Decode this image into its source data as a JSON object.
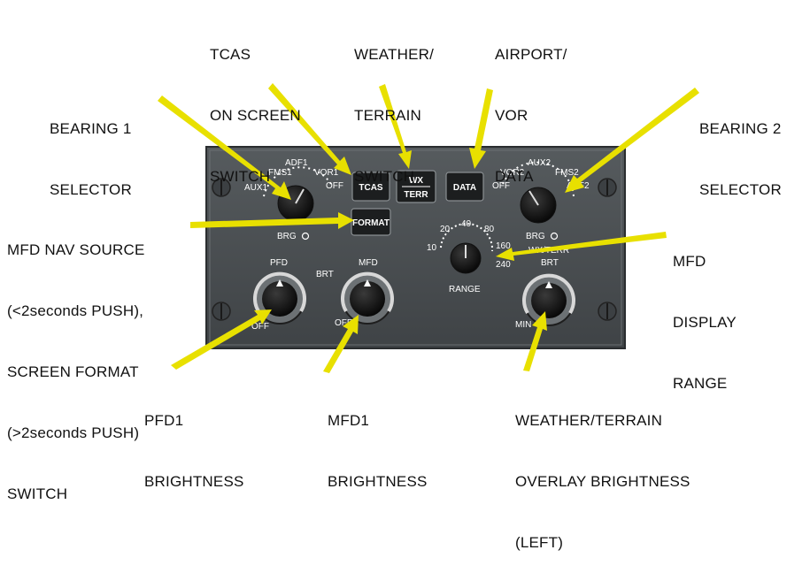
{
  "callouts": {
    "tcas_switch": [
      "TCAS",
      "ON SCREEN",
      "SWITCH"
    ],
    "weather_terrain_switch": [
      "WEATHER/",
      "TERRAIN",
      "SWITCH"
    ],
    "airport_vor_data": [
      "AIRPORT/",
      "VOR",
      "DATA"
    ],
    "bearing1_selector": [
      "BEARING 1",
      "SELECTOR"
    ],
    "bearing2_selector": [
      "BEARING 2",
      "SELECTOR"
    ],
    "mfd_nav_source": [
      "MFD NAV SOURCE",
      "(<2seconds PUSH),",
      "SCREEN FORMAT",
      "(>2seconds PUSH)",
      "SWITCH"
    ],
    "mfd_display_range": [
      "MFD",
      "DISPLAY",
      "RANGE"
    ],
    "pfd1_brightness": [
      "PFD1",
      "BRIGHTNESS"
    ],
    "mfd1_brightness": [
      "MFD1",
      "BRIGHTNESS"
    ],
    "overlay_brightness": [
      "WEATHER/TERRAIN",
      "OVERLAY BRIGHTNESS",
      "(LEFT)"
    ]
  },
  "panel": {
    "buttons": {
      "tcas": "TCAS",
      "wx_top": "WX",
      "wx_bottom": "TERR",
      "data": "DATA",
      "format": "FORMAT"
    },
    "bearing1": {
      "labels": [
        "AUX1",
        "FMS1",
        "ADF1",
        "VOR1",
        "OFF"
      ],
      "brg": "BRG"
    },
    "bearing2": {
      "labels": [
        "OFF",
        "VOR2",
        "AUX2",
        "FMS2",
        "ADF2"
      ],
      "brg": "BRG"
    },
    "range": {
      "ticks": [
        "10",
        "20",
        "40",
        "80",
        "160",
        "240"
      ],
      "label": "RANGE"
    },
    "pfd": {
      "top": "PFD",
      "off": "OFF"
    },
    "mfd": {
      "top": "MFD",
      "off": "OFF"
    },
    "brt_left": "BRT",
    "wxterr": {
      "top": "WX/TERR",
      "brt": "BRT",
      "min": "MIN"
    }
  },
  "colors": {
    "arrow": "#e8e000",
    "panel": "#4a4f52",
    "background": "#ffffff"
  }
}
